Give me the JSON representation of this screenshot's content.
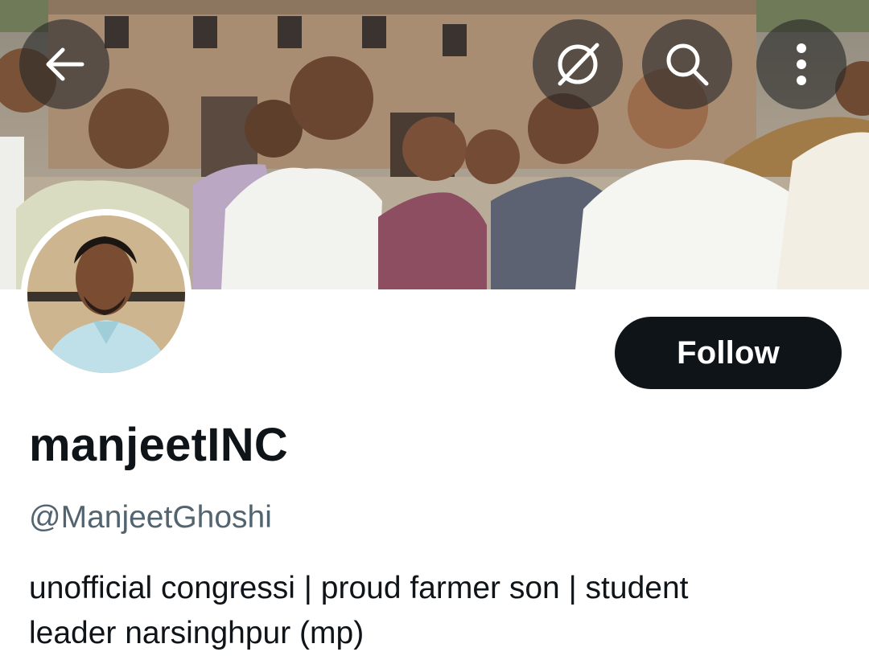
{
  "header": {
    "back_icon": "arrow-left-icon",
    "grok_icon": "grok-icon",
    "search_icon": "search-icon",
    "more_icon": "more-vertical-icon"
  },
  "profile": {
    "display_name": "manjeetINC",
    "handle": "@ManjeetGhoshi",
    "bio_line1": "unofficial congressi | proud farmer son | student",
    "bio_line2": "leader narsinghpur (mp)"
  },
  "actions": {
    "follow_label": "Follow"
  },
  "colors": {
    "follow_bg": "#0f1419",
    "handle_text": "#536471",
    "primary_text": "#0f1419"
  }
}
